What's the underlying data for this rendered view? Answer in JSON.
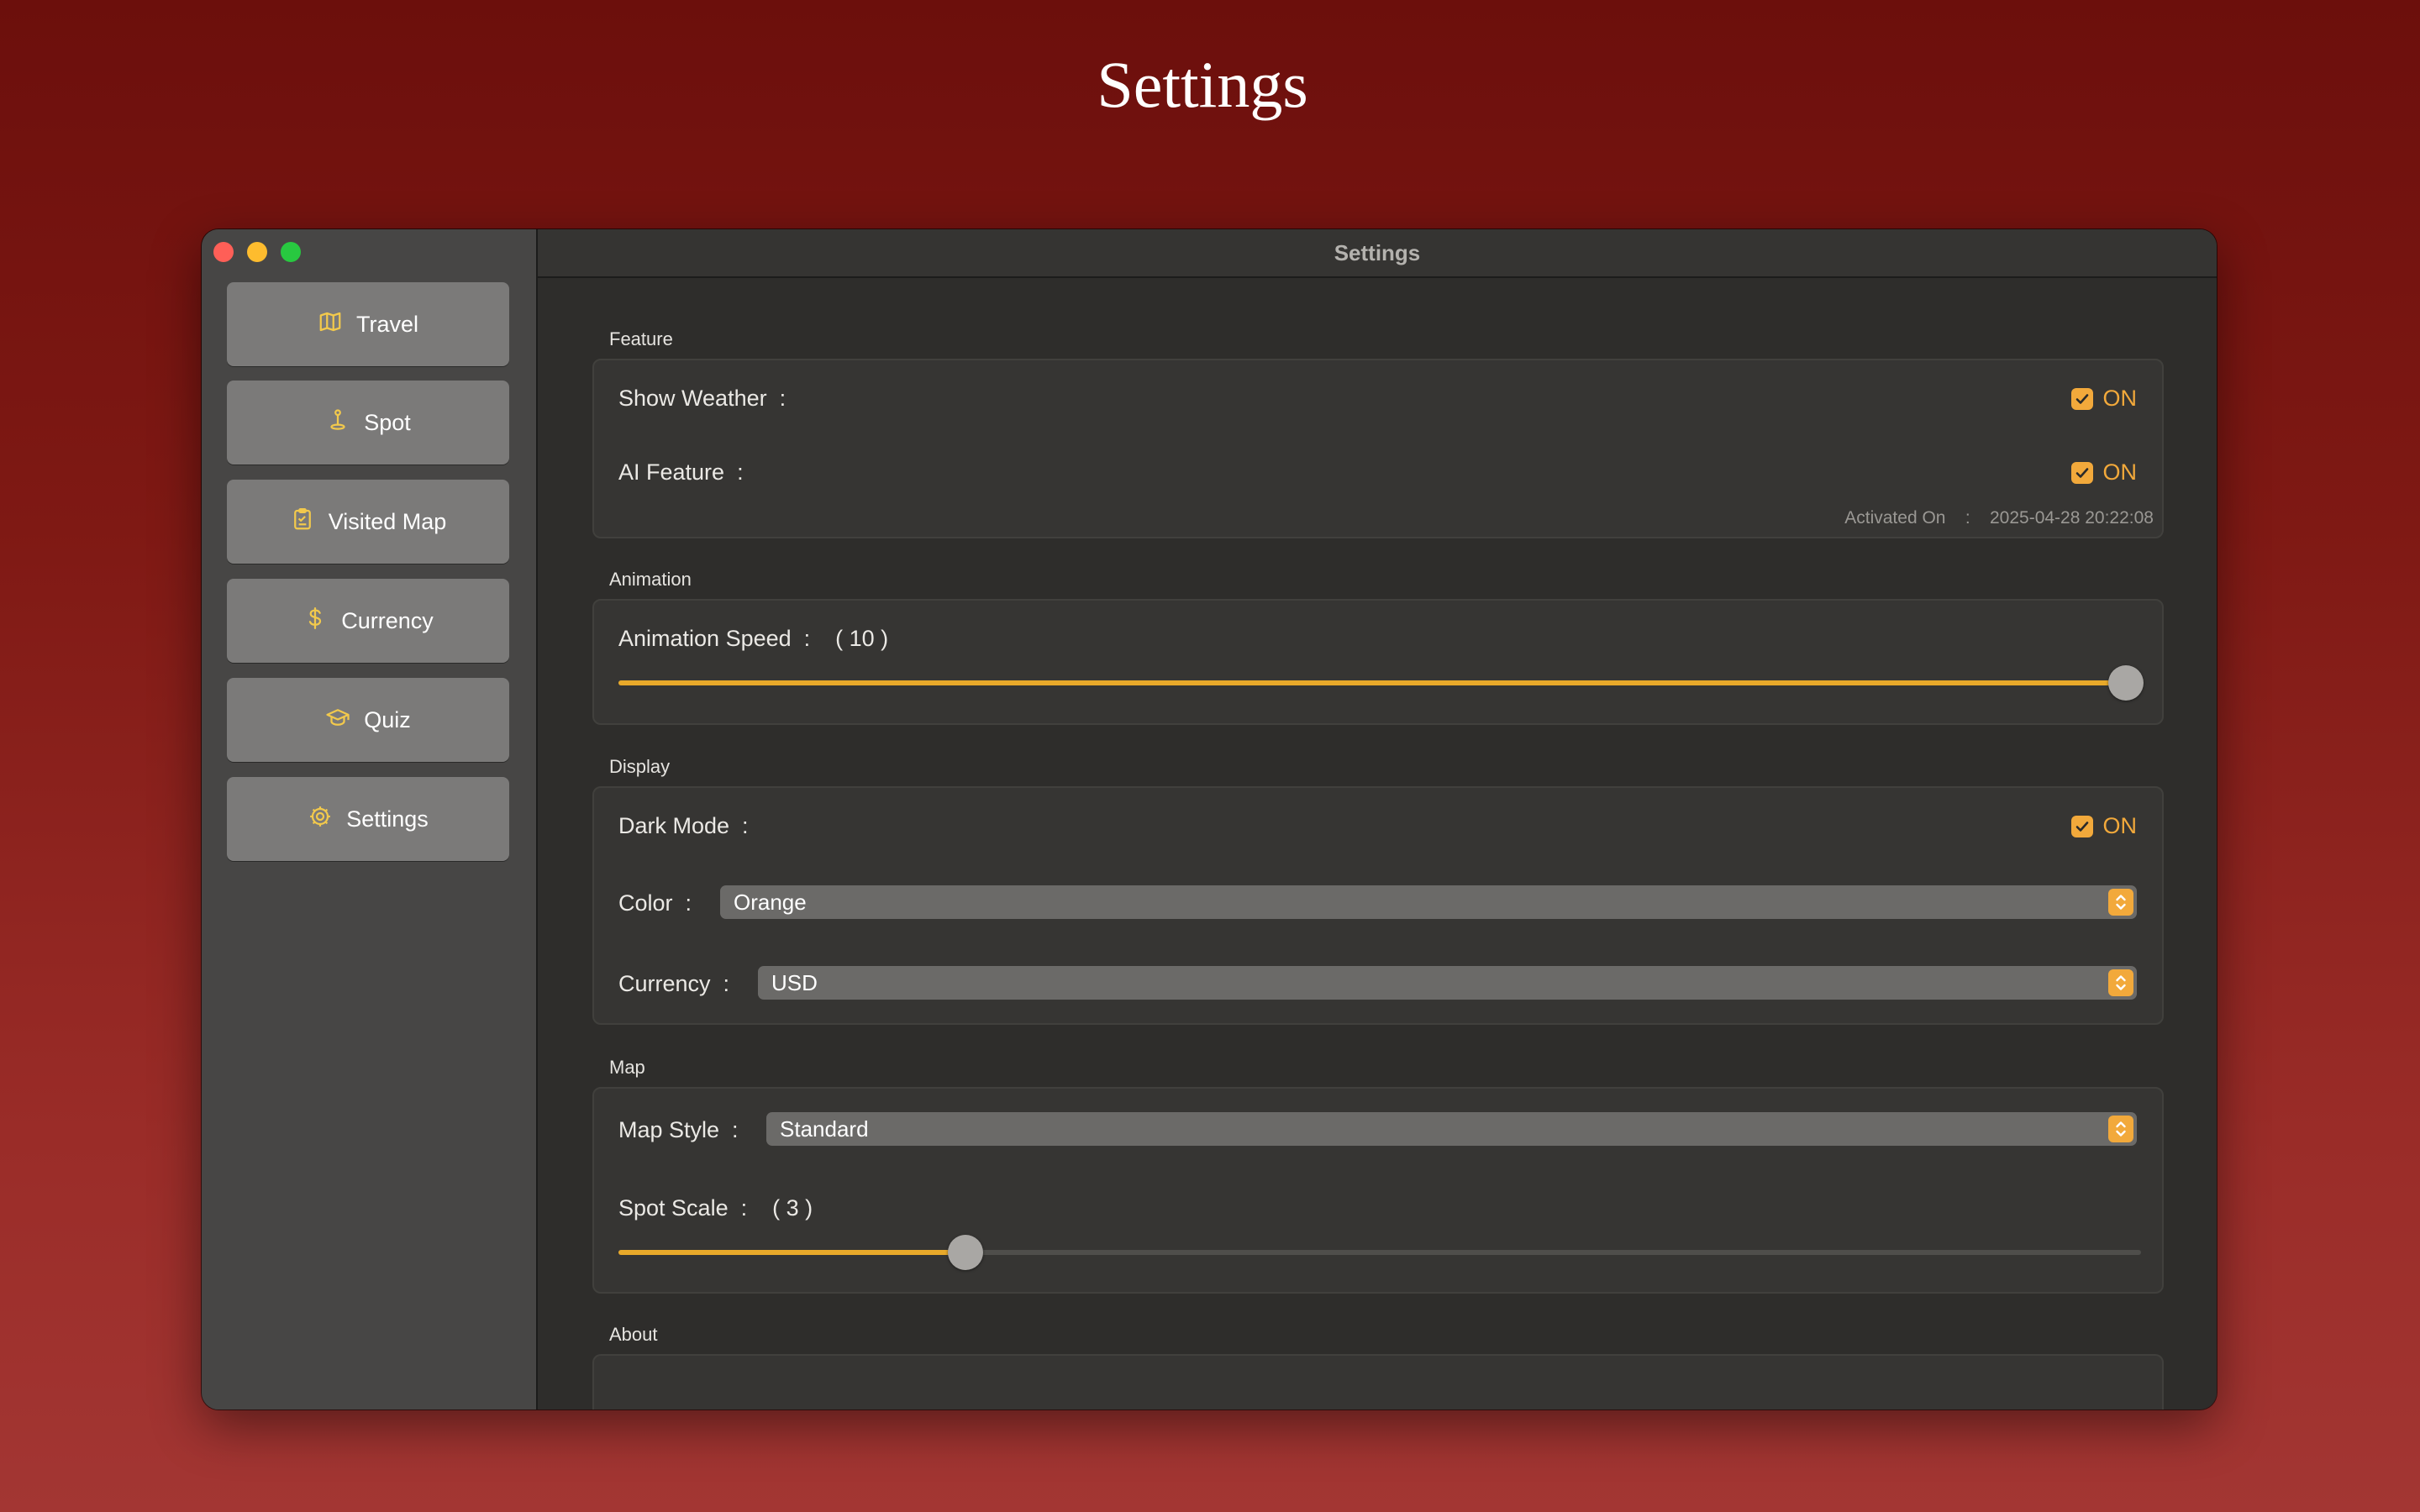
{
  "page": {
    "title": "Settings"
  },
  "window": {
    "title": "Settings"
  },
  "colors": {
    "accent": "#f2a93b",
    "background_top": "#6c0f0c",
    "background_bottom": "#a33633",
    "sidebar": "#474645",
    "nav_button": "#7b7a79"
  },
  "sidebar": {
    "items": [
      {
        "label": "Travel",
        "icon": "map-icon"
      },
      {
        "label": "Spot",
        "icon": "location-pin-icon"
      },
      {
        "label": "Visited Map",
        "icon": "clipboard-icon"
      },
      {
        "label": "Currency",
        "icon": "dollar-icon"
      },
      {
        "label": "Quiz",
        "icon": "graduation-cap-icon"
      },
      {
        "label": "Settings",
        "icon": "gear-icon"
      }
    ]
  },
  "sections": {
    "feature": {
      "label": "Feature",
      "show_weather": {
        "label": "Show Weather  :",
        "value": "ON",
        "checked": true
      },
      "ai_feature": {
        "label": "AI Feature  :",
        "value": "ON",
        "checked": true
      },
      "activated": "Activated On    :    2025-04-28 20:22:08"
    },
    "animation": {
      "label": "Animation",
      "speed_label": "Animation Speed  :    ( 10 )",
      "speed_value": 10,
      "speed_fraction": 0.99
    },
    "display": {
      "label": "Display",
      "dark_mode": {
        "label": "Dark Mode  :",
        "value": "ON",
        "checked": true
      },
      "color": {
        "label": "Color  :",
        "value": "Orange"
      },
      "currency": {
        "label": "Currency  :",
        "value": "USD"
      }
    },
    "map": {
      "label": "Map",
      "style": {
        "label": "Map Style  :",
        "value": "Standard"
      },
      "spot_scale_label": "Spot Scale  :    ( 3 )",
      "spot_scale_value": 3,
      "spot_scale_fraction": 0.228
    },
    "about": {
      "label": "About"
    }
  }
}
